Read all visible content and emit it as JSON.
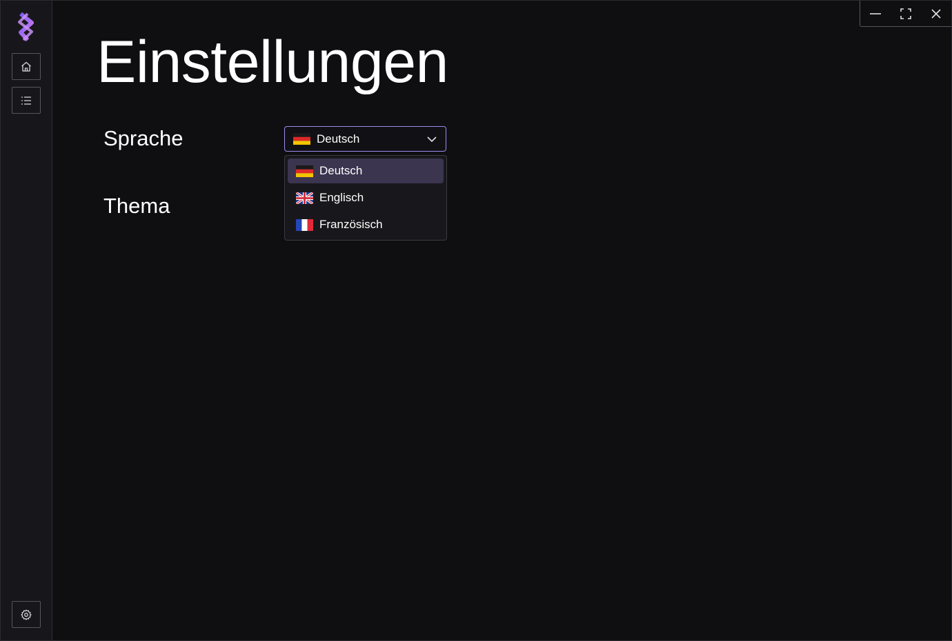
{
  "window": {
    "controls": [
      "minimize-icon",
      "maximize-icon",
      "close-icon"
    ]
  },
  "sidebar": {
    "logo": "app-logo",
    "buttons": [
      {
        "icon": "home-icon"
      },
      {
        "icon": "list-icon"
      },
      {
        "icon": "gear-icon"
      }
    ]
  },
  "page": {
    "title": "Einstellungen"
  },
  "settings": {
    "language_label": "Sprache",
    "theme_label": "Thema",
    "language_select": {
      "selected": "Deutsch",
      "selected_flag": "germany-flag-icon",
      "options": [
        {
          "label": "Deutsch",
          "flag": "germany-flag-icon"
        },
        {
          "label": "Englisch",
          "flag": "uk-flag-icon"
        },
        {
          "label": "Französisch",
          "flag": "france-flag-icon"
        }
      ]
    }
  },
  "colors": {
    "accent": "#9d8cf0",
    "selected_item_bg": "#3b3550",
    "background": "#0f0f12",
    "sidebar_bg": "#17171b"
  }
}
